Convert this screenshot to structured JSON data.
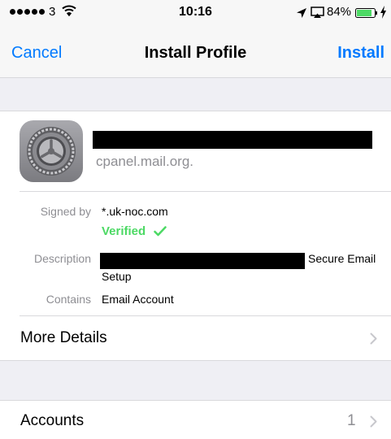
{
  "status_bar": {
    "carrier": "3",
    "time": "10:16",
    "battery": "84%"
  },
  "nav": {
    "cancel_label": "Cancel",
    "title": "Install Profile",
    "install_label": "Install"
  },
  "profile": {
    "host": "cpanel.mail.org.",
    "signed_by_label": "Signed by",
    "signed_by_value": "*.uk-noc.com",
    "verified_label": "Verified",
    "description_label": "Description",
    "description_value_tail": "Secure Email",
    "description_value_line2": "Setup",
    "contains_label": "Contains",
    "contains_value": "Email Account",
    "more_details_label": "More Details"
  },
  "accounts": {
    "label": "Accounts",
    "count": "1"
  },
  "colors": {
    "accent": "#007aff",
    "verified": "#4cd964",
    "secondary_text": "#8e8e93",
    "background": "#efeff4"
  },
  "icons": {
    "profile_icon": "settings-gear-icon",
    "status": [
      "signal-dots-icon",
      "wifi-icon",
      "location-arrow-icon",
      "airplay-icon",
      "battery-icon",
      "charging-bolt-icon"
    ],
    "disclosure": "chevron-right-icon",
    "verified": "checkmark-icon"
  }
}
